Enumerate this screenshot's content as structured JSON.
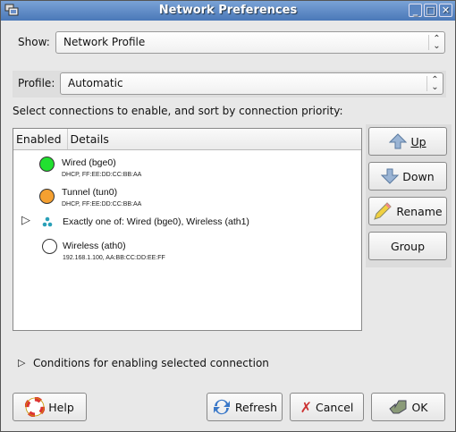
{
  "window": {
    "title": "Network Preferences",
    "minimize": "_",
    "maximize": "□",
    "close": "✕"
  },
  "show": {
    "label": "Show:",
    "value": "Network Profile"
  },
  "profile": {
    "label": "Profile:",
    "value": "Automatic"
  },
  "instructions": "Select connections to enable, and sort by connection priority:",
  "list": {
    "columns": [
      "Enabled",
      "Details"
    ],
    "rows": [
      {
        "name": "Wired (bge0)",
        "detail": "DHCP, FF:EE:DD:CC:BB:AA",
        "status_color": "#22e030"
      },
      {
        "name": "Tunnel (tun0)",
        "detail": "DHCP, FF:EE:DD:CC:BB:AA",
        "status_color": "#f5a030"
      },
      {
        "name": "Exactly one of: Wired (bge0), Wireless (ath1)"
      },
      {
        "name": "Wireless (ath0)",
        "detail": "192.168.1.100, AA:BB:CC:DD:EE:FF",
        "status_color": "#ffffff"
      }
    ]
  },
  "side_buttons": {
    "up": "Up",
    "down": "Down",
    "rename": "Rename",
    "group": "Group"
  },
  "conditions": "Conditions for enabling selected connection",
  "bottom": {
    "help": "Help",
    "refresh": "Refresh",
    "cancel": "Cancel",
    "ok": "OK"
  }
}
